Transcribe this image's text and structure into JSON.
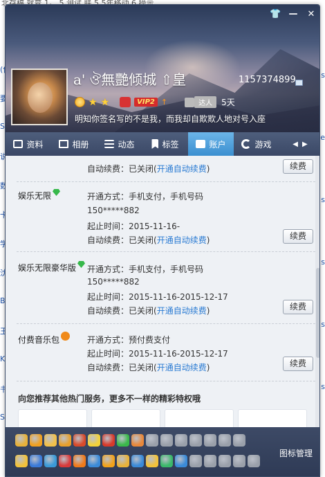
{
  "background": {
    "top_text": "北存稿 就变 1。 5 测试 联 5 5年移动 6 操示",
    "left_fragments": [
      "(使",
      "要",
      "S",
      "说",
      "数",
      "卡",
      "学",
      "沈",
      "B",
      "王",
      "K",
      "书",
      "S"
    ],
    "right_fragments": [
      "s",
      "e",
      "s",
      "s",
      "s",
      "s"
    ]
  },
  "window": {
    "buttons": [
      "皮肤",
      "最小化",
      "关闭"
    ],
    "button_glyphs": [
      "👕",
      "—",
      "✕"
    ]
  },
  "profile": {
    "nickname": "a' ঔ無艷倾城    ⇧皇",
    "uid": "1157374899",
    "vip_label": "VIP2",
    "daren_label": "达人",
    "days": "5天",
    "signature": "明知你签名写的不是我，而我却自欺欺人地对号入座"
  },
  "tabs": [
    {
      "label": "资料",
      "icon": "profile-card-icon"
    },
    {
      "label": "相册",
      "icon": "album-icon"
    },
    {
      "label": "动态",
      "icon": "feed-list-icon"
    },
    {
      "label": "标签",
      "icon": "tag-flag-icon"
    },
    {
      "label": "账户",
      "icon": "wallet-icon",
      "active": true
    },
    {
      "label": "游戏",
      "icon": "game-rocket-icon"
    }
  ],
  "tab_arrows": [
    "◀",
    "▶"
  ],
  "items": [
    {
      "name": "",
      "lines": [
        {
          "label": "自动续费：已关闭(",
          "link": "开通自动续费",
          "suffix": ")"
        }
      ],
      "button": "续费"
    },
    {
      "name": "娱乐无限",
      "lines": [
        {
          "label": "开通方式：手机支付，手机号码"
        },
        {
          "label": "150*****882"
        },
        {
          "label": "起止时间：2015-11-16-"
        },
        {
          "label": "自动续费：已关闭(",
          "link": "开通自动续费",
          "suffix": ")"
        }
      ],
      "button": "续费"
    },
    {
      "name": "娱乐无限豪华版",
      "lines": [
        {
          "label": "开通方式：手机支付，手机号码"
        },
        {
          "label": "150*****882"
        },
        {
          "label": "起止时间：2015-11-16-2015-12-17"
        },
        {
          "label": "自动续费：已关闭(",
          "link": "开通自动续费",
          "suffix": ")"
        }
      ],
      "button": "续费"
    },
    {
      "name": "付费音乐包",
      "lines": [
        {
          "label": "开通方式：预付费支付"
        },
        {
          "label": "起止时间：2015-11-16-2015-12-17"
        },
        {
          "label": "自动续费：已关闭(",
          "link": "开通自动续费",
          "suffix": ")"
        }
      ],
      "button": "续费"
    }
  ],
  "recommend_title": "向您推荐其他热门服务，更多不一样的精彩特权哦",
  "dock": {
    "manage_label": "图标管理",
    "row1_colors": [
      "#e8b23a",
      "#f0a020",
      "#f2c04a",
      "#e8a02c",
      "#d84a2a",
      "#f2d23a",
      "#d83a2a",
      "#3ab84a",
      "#e8883a",
      "#9aa0aa",
      "#9aa0aa",
      "#9aa0aa",
      "#9aa0aa",
      "#9aa0aa",
      "#9aa0aa",
      "#9aa0aa"
    ],
    "row2_colors": [
      "#f2c23a",
      "#3a7ad8",
      "#3a9ad8",
      "#d83a3a",
      "#f07a1a",
      "#3a8ad8",
      "#f2a21a",
      "#e8b23a",
      "#3a8ad8",
      "#f2c23a",
      "#3ab86a",
      "#3a8ad8",
      "#9aa0aa",
      "#9aa0aa",
      "#9aa0aa",
      "#9aa0aa",
      "#9aa0aa"
    ]
  }
}
